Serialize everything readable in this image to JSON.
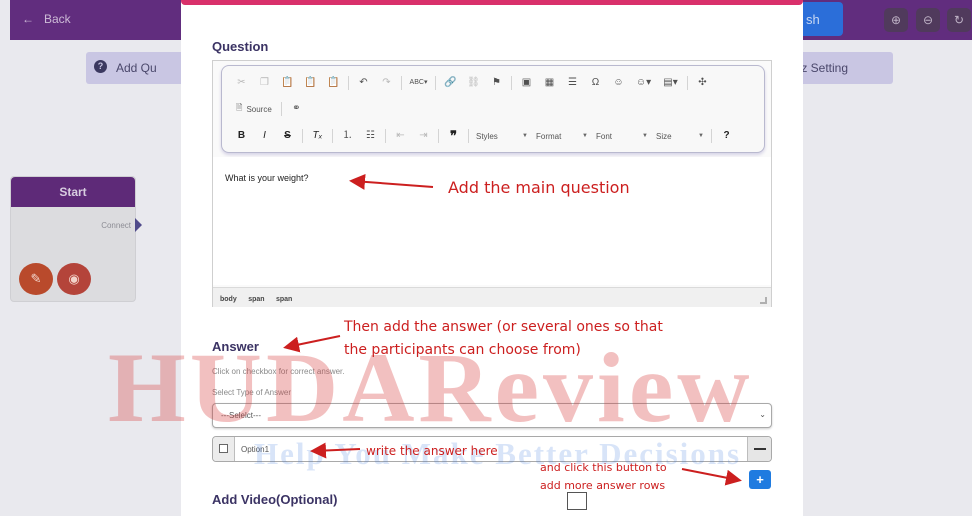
{
  "background_app": {
    "back_label": "Back",
    "publish_label": "sh",
    "add_question_label": "Add Qu",
    "quiz_setting_label": "uiz Setting",
    "start_node": {
      "title": "Start",
      "connect_label": "Connect"
    }
  },
  "modal": {
    "question_title": "Question",
    "toolbar": {
      "source_label": "Source",
      "styles_label": "Styles",
      "format_label": "Format",
      "font_label": "Font",
      "size_label": "Size",
      "help_label": "?",
      "spell_label": "ABC"
    },
    "editor_text": "What is your weight?",
    "element_path": [
      "body",
      "span",
      "span"
    ],
    "answer_title": "Answer",
    "answer_hint": "Click on checkbox for correct answer.",
    "select_type_label": "Select Type of Answer",
    "select_value": "---Selelct---",
    "option_value": "Option1",
    "add_video_title": "Add Video(Optional)"
  },
  "annotations": {
    "main_question": "Add the main question",
    "answer_line1": "Then add the answer (or several ones so that",
    "answer_line2": "the participants can choose from)",
    "write_answer": "write the answer here",
    "click_button_line1": "and click this button to",
    "click_button_line2": "add more answer rows"
  },
  "watermark": {
    "brand": "HUDAReview",
    "tagline": "Help You Make Better Decisions"
  },
  "colors": {
    "topbar": "#612d7e",
    "modal_accent": "#d9306b",
    "annotation_red": "#cc1f1f",
    "add_button_blue": "#1f7be0"
  }
}
